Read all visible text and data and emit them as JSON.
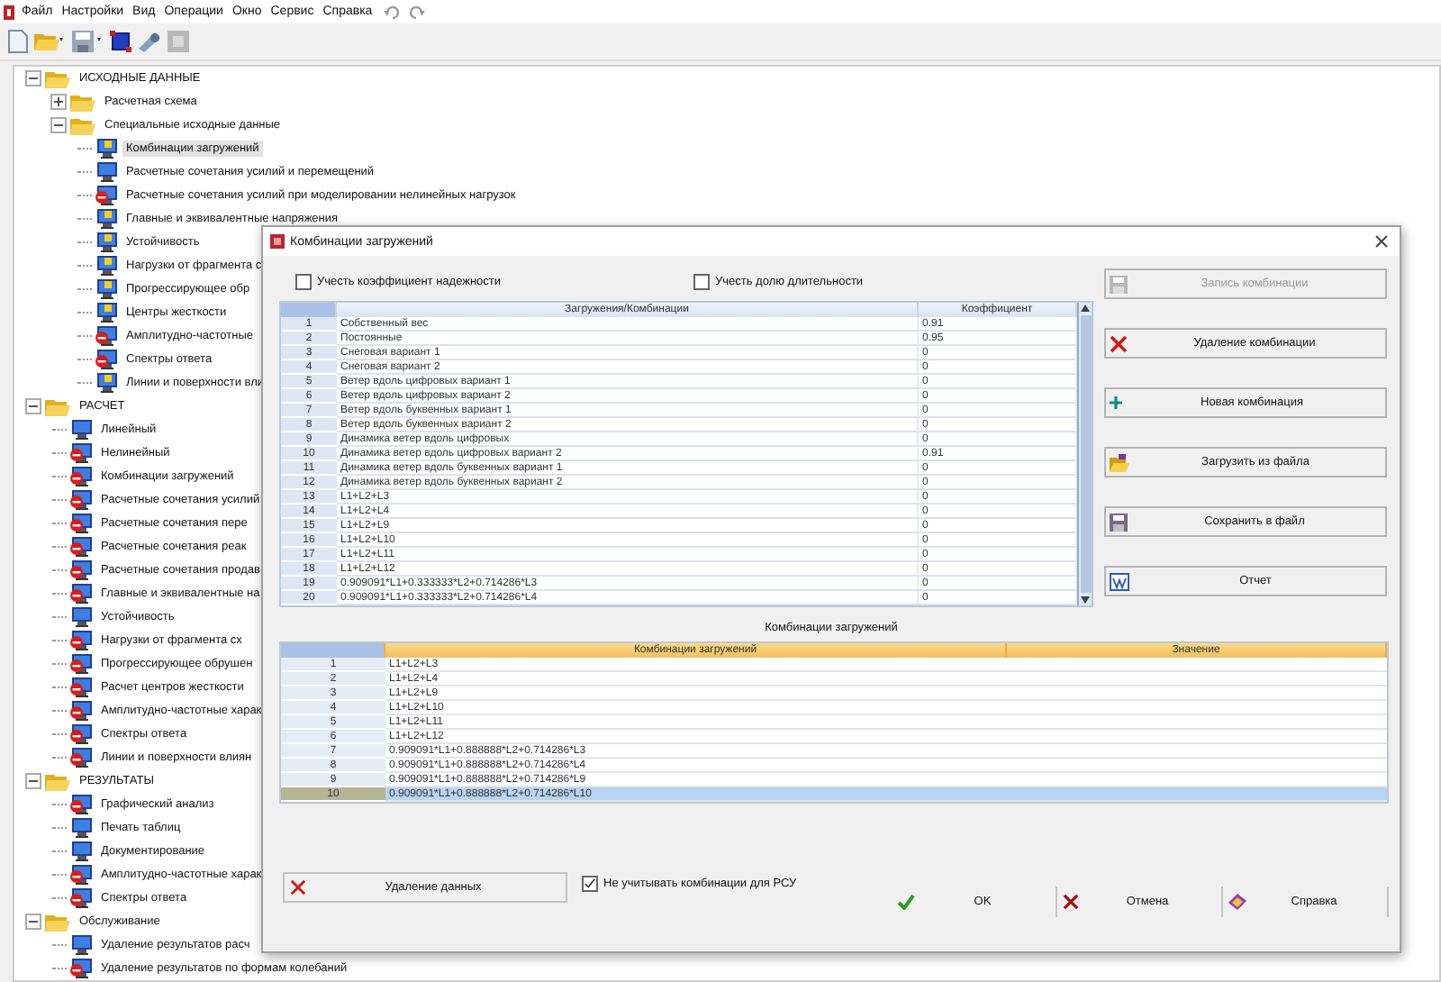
{
  "menu": [
    "Файл",
    "Настройки",
    "Вид",
    "Операции",
    "Окно",
    "Сервис",
    "Справка"
  ],
  "tree": [
    {
      "kind": "folder",
      "label": "ИСХОДНЫЕ ДАННЫЕ",
      "expanded": true,
      "selected": false,
      "children": [
        {
          "kind": "folder",
          "label": "Расчетная схема",
          "expanded": false,
          "selected": false
        },
        {
          "kind": "folder",
          "label": "Специальные исходные данные",
          "expanded": true,
          "selected": false,
          "children": [
            {
              "kind": "leaf",
              "label": "Комбинации загружений",
              "warning": true,
              "blocked": false,
              "selected": true
            },
            {
              "kind": "leaf",
              "label": "Расчетные сочетания усилий и перемещений",
              "warning": false,
              "blocked": false,
              "selected": false
            },
            {
              "kind": "leaf",
              "label": "Расчетные сочетания усилий при моделировании нелинейных нагрузок",
              "warning": false,
              "blocked": true,
              "selected": false
            },
            {
              "kind": "leaf",
              "label": "Главные и эквивалентные напряжения",
              "warning": true,
              "blocked": false,
              "selected": false
            },
            {
              "kind": "leaf",
              "label": "Устойчивость",
              "warning": true,
              "blocked": false,
              "selected": false
            },
            {
              "kind": "leaf",
              "label": "Нагрузки от фрагмента с",
              "warning": true,
              "blocked": false,
              "selected": false
            },
            {
              "kind": "leaf",
              "label": "Прогрессирующее обр",
              "warning": true,
              "blocked": false,
              "selected": false
            },
            {
              "kind": "leaf",
              "label": "Центры жесткости",
              "warning": true,
              "blocked": false,
              "selected": false
            },
            {
              "kind": "leaf",
              "label": "Амплитудно-частотные",
              "warning": false,
              "blocked": true,
              "selected": false
            },
            {
              "kind": "leaf",
              "label": "Спектры ответа",
              "warning": false,
              "blocked": true,
              "selected": false
            },
            {
              "kind": "leaf",
              "label": "Линии и поверхности вли",
              "warning": true,
              "blocked": false,
              "selected": false
            }
          ]
        }
      ]
    },
    {
      "kind": "folder",
      "label": "РАСЧЕТ",
      "expanded": true,
      "selected": false,
      "children": [
        {
          "kind": "leaf",
          "label": "Линейный",
          "warning": false,
          "blocked": false,
          "selected": false
        },
        {
          "kind": "leaf",
          "label": "Нелинейный",
          "warning": false,
          "blocked": true,
          "selected": false
        },
        {
          "kind": "leaf",
          "label": "Комбинации загружений",
          "warning": false,
          "blocked": true,
          "selected": false
        },
        {
          "kind": "leaf",
          "label": "Расчетные сочетания усилий",
          "warning": false,
          "blocked": true,
          "selected": false
        },
        {
          "kind": "leaf",
          "label": "Расчетные сочетания пере",
          "warning": false,
          "blocked": true,
          "selected": false
        },
        {
          "kind": "leaf",
          "label": "Расчетные сочетания реак",
          "warning": false,
          "blocked": true,
          "selected": false
        },
        {
          "kind": "leaf",
          "label": "Расчетные сочетания продав",
          "warning": false,
          "blocked": true,
          "selected": false
        },
        {
          "kind": "leaf",
          "label": "Главные и эквивалентные на",
          "warning": false,
          "blocked": true,
          "selected": false
        },
        {
          "kind": "leaf",
          "label": "Устойчивость",
          "warning": false,
          "blocked": false,
          "selected": false
        },
        {
          "kind": "leaf",
          "label": "Нагрузки от фрагмента сх",
          "warning": false,
          "blocked": true,
          "selected": false
        },
        {
          "kind": "leaf",
          "label": "Прогрессирующее обрушен",
          "warning": false,
          "blocked": true,
          "selected": false
        },
        {
          "kind": "leaf",
          "label": "Расчет центров жесткости",
          "warning": false,
          "blocked": true,
          "selected": false
        },
        {
          "kind": "leaf",
          "label": "Амплитудно-частотные харак",
          "warning": false,
          "blocked": true,
          "selected": false
        },
        {
          "kind": "leaf",
          "label": "Спектры ответа",
          "warning": false,
          "blocked": true,
          "selected": false
        },
        {
          "kind": "leaf",
          "label": "Линии и поверхности влиян",
          "warning": false,
          "blocked": true,
          "selected": false
        }
      ]
    },
    {
      "kind": "folder",
      "label": "РЕЗУЛЬТАТЫ",
      "expanded": true,
      "selected": false,
      "children": [
        {
          "kind": "leaf",
          "label": "Графический анализ",
          "warning": false,
          "blocked": true,
          "selected": false
        },
        {
          "kind": "leaf",
          "label": "Печать таблиц",
          "warning": false,
          "blocked": false,
          "selected": false
        },
        {
          "kind": "leaf",
          "label": "Документирование",
          "warning": false,
          "blocked": false,
          "selected": false
        },
        {
          "kind": "leaf",
          "label": "Амплитудно-частотные харак",
          "warning": false,
          "blocked": true,
          "selected": false
        },
        {
          "kind": "leaf",
          "label": "Спектры ответа",
          "warning": false,
          "blocked": true,
          "selected": false
        }
      ]
    },
    {
      "kind": "folder",
      "label": "Обслуживание",
      "expanded": true,
      "selected": false,
      "children": [
        {
          "kind": "leaf",
          "label": "Удаление результатов расч",
          "warning": false,
          "blocked": false,
          "selected": false
        },
        {
          "kind": "leaf",
          "label": "Удаление результатов по формам колебаний",
          "warning": false,
          "blocked": true,
          "selected": false
        }
      ]
    }
  ],
  "dialog": {
    "title": "Комбинации загружений",
    "options": [
      {
        "label": "Учесть коэффициент надежности",
        "checked": false
      },
      {
        "label": "Учесть долю длительности",
        "checked": false
      }
    ],
    "loads_table": {
      "columns": [
        "Загружения/Комбинации",
        "Коэффициент"
      ],
      "rows": [
        {
          "n": "1",
          "name": "Собственный вес",
          "coef": "0.91"
        },
        {
          "n": "2",
          "name": "Постоянные",
          "coef": "0.95"
        },
        {
          "n": "3",
          "name": "Снеговая вариант 1",
          "coef": "0"
        },
        {
          "n": "4",
          "name": "Снеговая вариант 2",
          "coef": "0"
        },
        {
          "n": "5",
          "name": "Ветер вдоль цифровых вариант 1",
          "coef": "0"
        },
        {
          "n": "6",
          "name": "Ветер вдоль цифровых вариант 2",
          "coef": "0"
        },
        {
          "n": "7",
          "name": "Ветер вдоль буквенных вариант 1",
          "coef": "0"
        },
        {
          "n": "8",
          "name": "Ветер вдоль буквенных вариант 2",
          "coef": "0"
        },
        {
          "n": "9",
          "name": "Динамика ветер вдоль цифровых",
          "coef": "0"
        },
        {
          "n": "10",
          "name": "Динамика ветер вдоль цифровых вариант 2",
          "coef": "0.91"
        },
        {
          "n": "11",
          "name": "Динамика ветер вдоль буквенных вариант 1",
          "coef": "0"
        },
        {
          "n": "12",
          "name": "Динамика ветер вдоль буквенных вариант 2",
          "coef": "0"
        },
        {
          "n": "13",
          "name": "L1+L2+L3",
          "coef": "0"
        },
        {
          "n": "14",
          "name": "L1+L2+L4",
          "coef": "0"
        },
        {
          "n": "15",
          "name": "L1+L2+L9",
          "coef": "0"
        },
        {
          "n": "16",
          "name": "L1+L2+L10",
          "coef": "0"
        },
        {
          "n": "17",
          "name": "L1+L2+L11",
          "coef": "0"
        },
        {
          "n": "18",
          "name": "L1+L2+L12",
          "coef": "0"
        },
        {
          "n": "19",
          "name": "0.909091*L1+0.333333*L2+0.714286*L3",
          "coef": "0"
        },
        {
          "n": "20",
          "name": "0.909091*L1+0.333333*L2+0.714286*L4",
          "coef": "0"
        }
      ]
    },
    "side_buttons": [
      {
        "kind": "save",
        "label": "Запись комбинации",
        "disabled": true
      },
      {
        "kind": "delete",
        "label": "Удаление комбинации",
        "disabled": false
      },
      {
        "kind": "add",
        "label": "Новая комбинация",
        "disabled": false
      },
      {
        "kind": "open",
        "label": "Загрузить из файла",
        "disabled": false
      },
      {
        "kind": "save",
        "label": "Сохранить в файл",
        "disabled": false
      },
      {
        "kind": "report",
        "label": "Отчет",
        "disabled": false
      }
    ],
    "combos_title": "Комбинации загружений",
    "combos_table": {
      "columns": [
        "Комбинации загружений",
        "Значение"
      ],
      "rows": [
        {
          "n": "1",
          "name": "L1+L2+L3",
          "selected": false
        },
        {
          "n": "2",
          "name": "L1+L2+L4",
          "selected": false
        },
        {
          "n": "3",
          "name": "L1+L2+L9",
          "selected": false
        },
        {
          "n": "4",
          "name": "L1+L2+L10",
          "selected": false
        },
        {
          "n": "5",
          "name": "L1+L2+L11",
          "selected": false
        },
        {
          "n": "6",
          "name": "L1+L2+L12",
          "selected": false
        },
        {
          "n": "7",
          "name": "0.909091*L1+0.888888*L2+0.714286*L3",
          "selected": false
        },
        {
          "n": "8",
          "name": "0.909091*L1+0.888888*L2+0.714286*L4",
          "selected": false
        },
        {
          "n": "9",
          "name": "0.909091*L1+0.888888*L2+0.714286*L9",
          "selected": false
        },
        {
          "n": "10",
          "name": "0.909091*L1+0.888888*L2+0.714286*L10",
          "selected": true
        }
      ]
    },
    "delete_data_button": "Удаление данных",
    "rsu_option": {
      "label": "Не учитывать комбинации для РСУ",
      "checked": true
    },
    "footer_buttons": [
      {
        "kind": "ok",
        "label": "OK"
      },
      {
        "kind": "cancel",
        "label": "Отмена"
      },
      {
        "kind": "help",
        "label": "Справка"
      }
    ]
  }
}
